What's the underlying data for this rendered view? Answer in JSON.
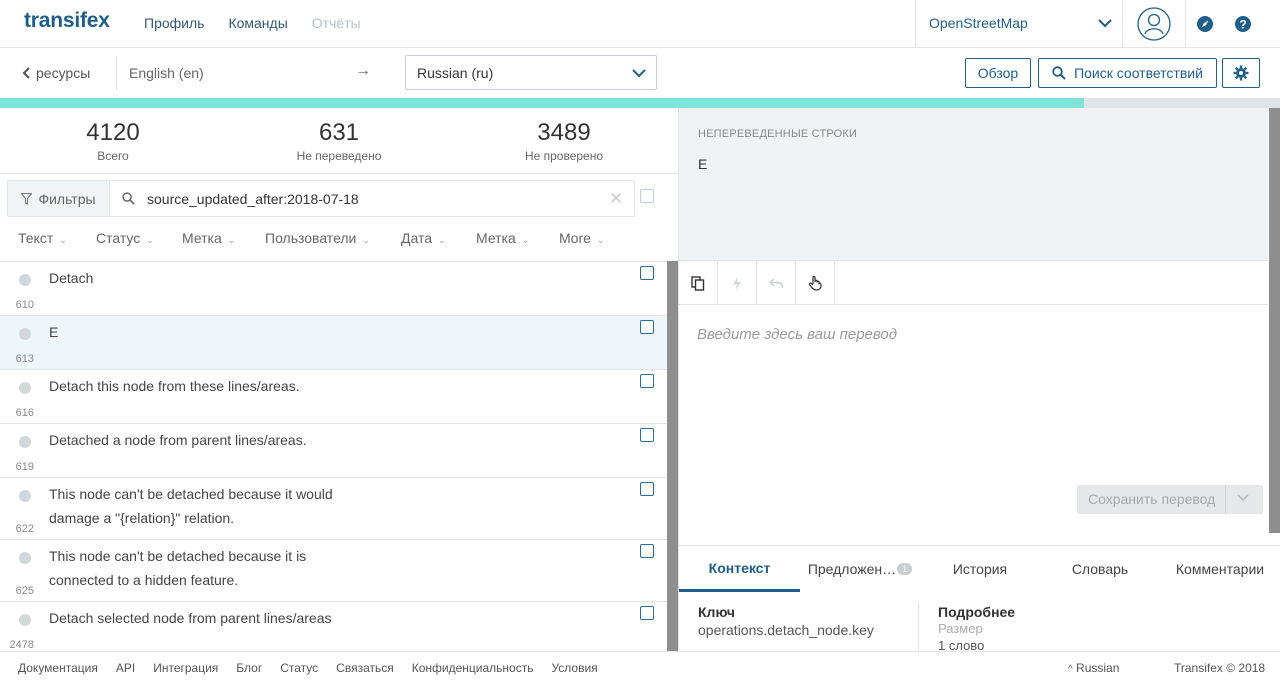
{
  "header": {
    "logo": "transifex",
    "nav": [
      "Профиль",
      "Команды",
      "Отчёты"
    ],
    "project": "OpenStreetMap"
  },
  "subbar": {
    "back_label": "ресурсы",
    "source_language": "English (en)",
    "arrow": "→",
    "target_language": "Russian (ru)",
    "review_button": "Обзор",
    "search_matches_button": "Поиск соответствий"
  },
  "progress": {
    "percent": 84.7
  },
  "stats": [
    {
      "value": "4120",
      "label": "Всего"
    },
    {
      "value": "631",
      "label": "Не переведено"
    },
    {
      "value": "3489",
      "label": "Не проверено"
    }
  ],
  "filter": {
    "button_label": "Фильтры",
    "query": "source_updated_after:2018-07-18",
    "clear": "✕"
  },
  "sort_columns": [
    "Текст",
    "Статус",
    "Метка",
    "Пользователи",
    "Дата",
    "Метка",
    "More"
  ],
  "strings": [
    {
      "lines": [
        "Detach"
      ],
      "id": "610",
      "selected": false
    },
    {
      "lines": [
        "E"
      ],
      "id": "613",
      "selected": true
    },
    {
      "lines": [
        "Detach this node from these lines/areas."
      ],
      "id": "616",
      "selected": false
    },
    {
      "lines": [
        "Detached a node from parent lines/areas."
      ],
      "id": "619",
      "selected": false
    },
    {
      "lines": [
        "This node can't be detached because it would",
        "damage a \"{relation}\" relation."
      ],
      "id": "622",
      "selected": false
    },
    {
      "lines": [
        "This node can't be detached because it is",
        "connected to a hidden feature."
      ],
      "id": "625",
      "selected": false
    },
    {
      "lines": [
        "Detach selected node from parent lines/areas"
      ],
      "id": "2478",
      "selected": false
    }
  ],
  "source_panel": {
    "label": "НЕПЕРЕВЕДЕННЫЕ СТРОКИ",
    "source_text": "E"
  },
  "editor": {
    "placeholder": "Введите здесь ваш перевод",
    "save_button": "Сохранить перевод"
  },
  "tabs": [
    {
      "label": "Контекст",
      "active": true
    },
    {
      "label": "Предложен…",
      "badge": "1",
      "active": false
    },
    {
      "label": "История",
      "active": false
    },
    {
      "label": "Словарь",
      "active": false
    },
    {
      "label": "Комментарии",
      "active": false
    }
  ],
  "context": {
    "key_heading": "Ключ",
    "key_value": "operations.detach_node.key",
    "details_heading": "Подробнее",
    "size_label": "Размер",
    "size_value": "1 слово"
  },
  "footer": {
    "links": [
      "Документация",
      "API",
      "Интеграция",
      "Блог",
      "Статус",
      "Связаться",
      "Конфиденциальность",
      "Условия"
    ],
    "language": "Russian",
    "language_caret": "^",
    "copyright": "Transifex © 2018"
  },
  "colors": {
    "brand": "#1f5f8b",
    "progress_fill": "#7ee3d8",
    "selected_row": "#eef5fb"
  }
}
